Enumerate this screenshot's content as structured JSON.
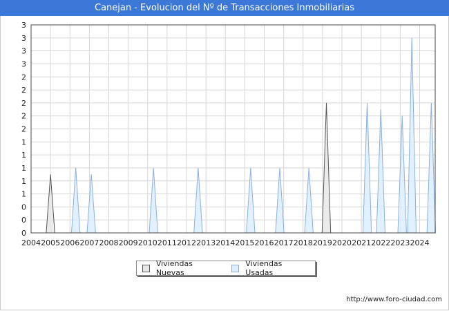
{
  "header": {
    "title": "Canejan - Evolucion del Nº de Transacciones Inmobiliarias"
  },
  "footer": {
    "url": "http://www.foro-ciudad.com"
  },
  "colors": {
    "nuevas_fill": "#e8e8e8",
    "nuevas_stroke": "#555555",
    "usadas_fill": "#ddeeff",
    "usadas_stroke": "#8ab0e0",
    "grid": "#d6d6d6",
    "axis": "#222222"
  },
  "chart_data": {
    "type": "area",
    "x_range": [
      2004,
      2024.8
    ],
    "y_range": [
      0,
      3.2
    ],
    "x_tick_labels": [
      "2004",
      "2005",
      "2006",
      "2007",
      "2008",
      "2009",
      "2010",
      "2011",
      "2012",
      "2013",
      "2014",
      "2015",
      "2016",
      "2017",
      "2018",
      "2019",
      "2020",
      "2021",
      "2022",
      "2023",
      "2024"
    ],
    "y_tick_labels": [
      "0",
      "0",
      "0",
      "1",
      "1",
      "1",
      "1",
      "1",
      "2",
      "2",
      "2",
      "2",
      "2",
      "3",
      "3",
      "3",
      "3"
    ],
    "grid": true,
    "legend_position": "bottom",
    "series": [
      {
        "name": "Viviendas Nuevas",
        "peaks": [
          [
            2005.0,
            0.9
          ],
          [
            2019.2,
            2.0
          ]
        ]
      },
      {
        "name": "Viviendas Usadas",
        "peaks": [
          [
            2006.3,
            1.0
          ],
          [
            2007.1,
            0.9
          ],
          [
            2010.3,
            1.0
          ],
          [
            2012.6,
            1.0
          ],
          [
            2015.3,
            1.0
          ],
          [
            2016.8,
            1.0
          ],
          [
            2018.3,
            1.0
          ],
          [
            2021.3,
            2.0
          ],
          [
            2022.0,
            1.9
          ],
          [
            2023.1,
            1.8
          ],
          [
            2023.6,
            3.0
          ],
          [
            2024.6,
            2.0
          ]
        ]
      }
    ]
  }
}
